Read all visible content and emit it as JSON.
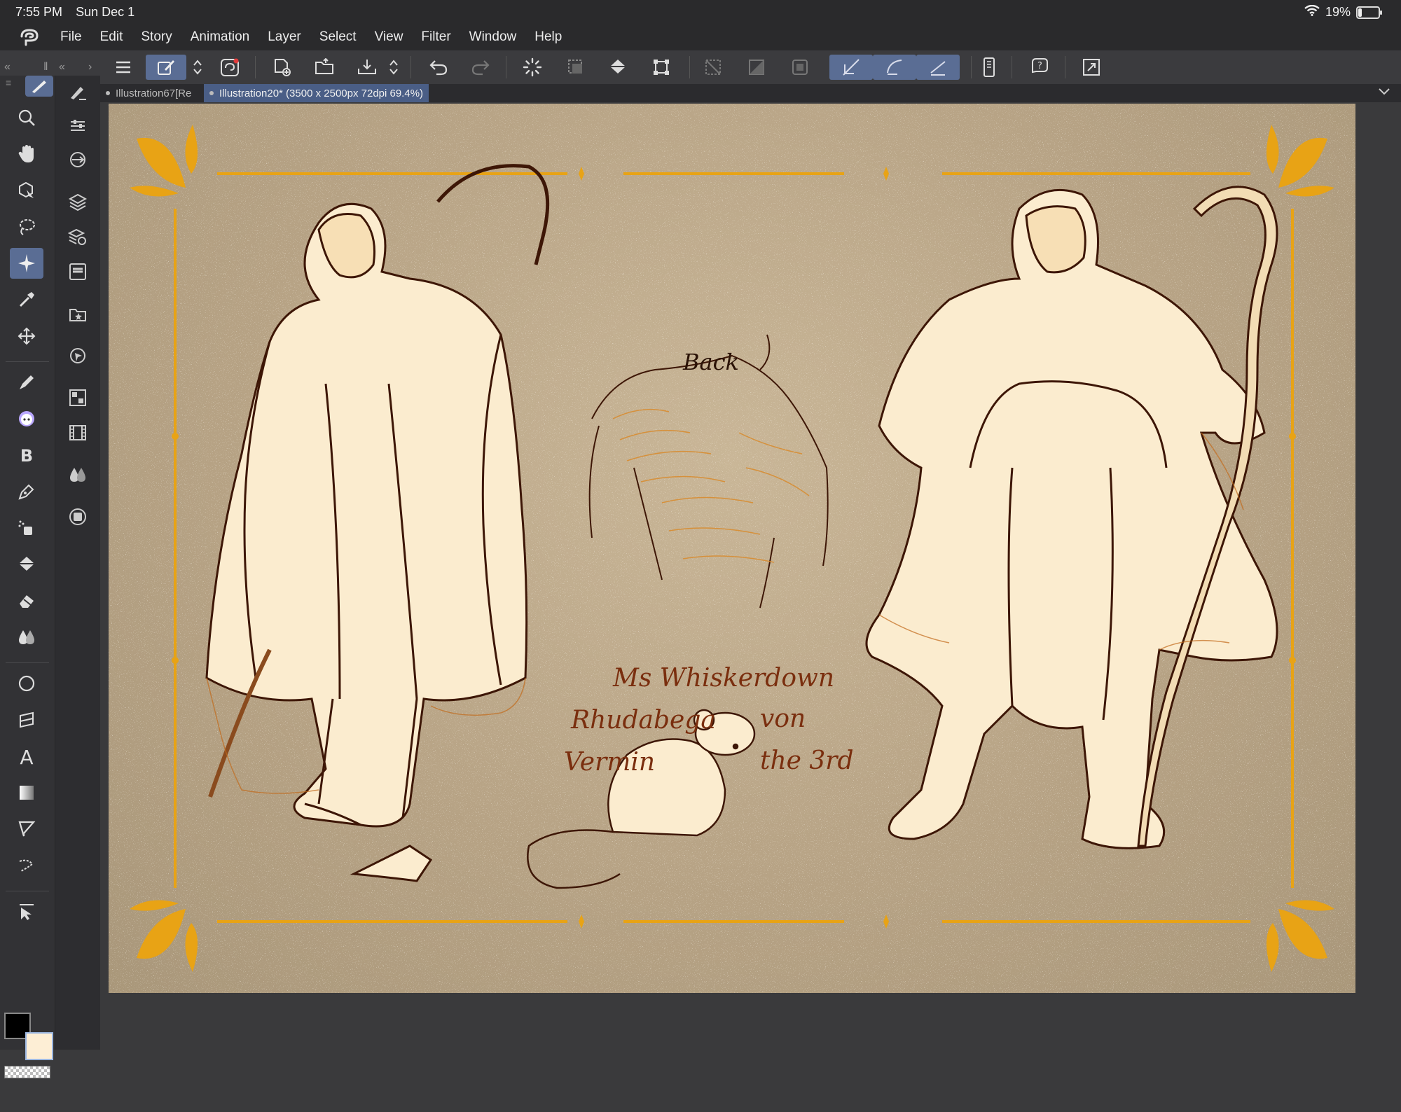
{
  "status_bar": {
    "time": "7:55 PM",
    "date": "Sun Dec 1",
    "battery": "19%",
    "battery_level": 0.19
  },
  "menu": {
    "items": [
      "File",
      "Edit",
      "Story",
      "Animation",
      "Layer",
      "Select",
      "View",
      "Filter",
      "Window",
      "Help"
    ]
  },
  "tabs": [
    {
      "label": "Illustration67[Re",
      "active": false
    },
    {
      "label": "Illustration20* (3500 x 2500px 72dpi 69.4%)",
      "active": true
    }
  ],
  "canvas_text": {
    "back": "Back",
    "name_line1": "Ms  Whiskerdown",
    "name_line2a": "Rhudabega",
    "name_line2b": "von",
    "name_line3a": "Vermin",
    "name_line3b": "the 3rd"
  },
  "colors": {
    "accent": "#5a6d94",
    "canvas_bg": "#b7a385",
    "frame_orange": "#e8a315",
    "line_brown": "#4a1e08",
    "skin_cream": "#fdeed5"
  }
}
